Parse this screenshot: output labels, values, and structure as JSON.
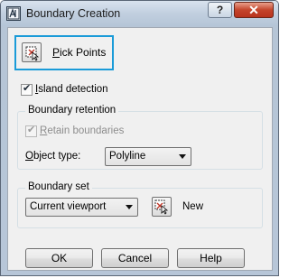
{
  "window": {
    "title": "Boundary Creation",
    "help_button": "?",
    "close_button": "✕"
  },
  "pick_points": {
    "label_prefix": "",
    "label_mnemonic": "P",
    "label_rest": "ick Points"
  },
  "island_detection": {
    "label_mnemonic": "I",
    "label_rest": "sland detection",
    "checked": true
  },
  "boundary_retention": {
    "title": "Boundary retention",
    "retain": {
      "label_mnemonic": "R",
      "label_rest": "etain boundaries",
      "checked": true,
      "disabled": true
    },
    "object_type": {
      "label_mnemonic": "O",
      "label_rest": "bject type:",
      "value": "Polyline"
    }
  },
  "boundary_set": {
    "title": "Boundary set",
    "value": "Current viewport",
    "new_label": "New"
  },
  "buttons": {
    "ok": "OK",
    "cancel": "Cancel",
    "help": "Help"
  },
  "colors": {
    "focus_highlight": "#1a9bd8",
    "titlebar": "#c1cfdf",
    "close": "#c4442b"
  }
}
